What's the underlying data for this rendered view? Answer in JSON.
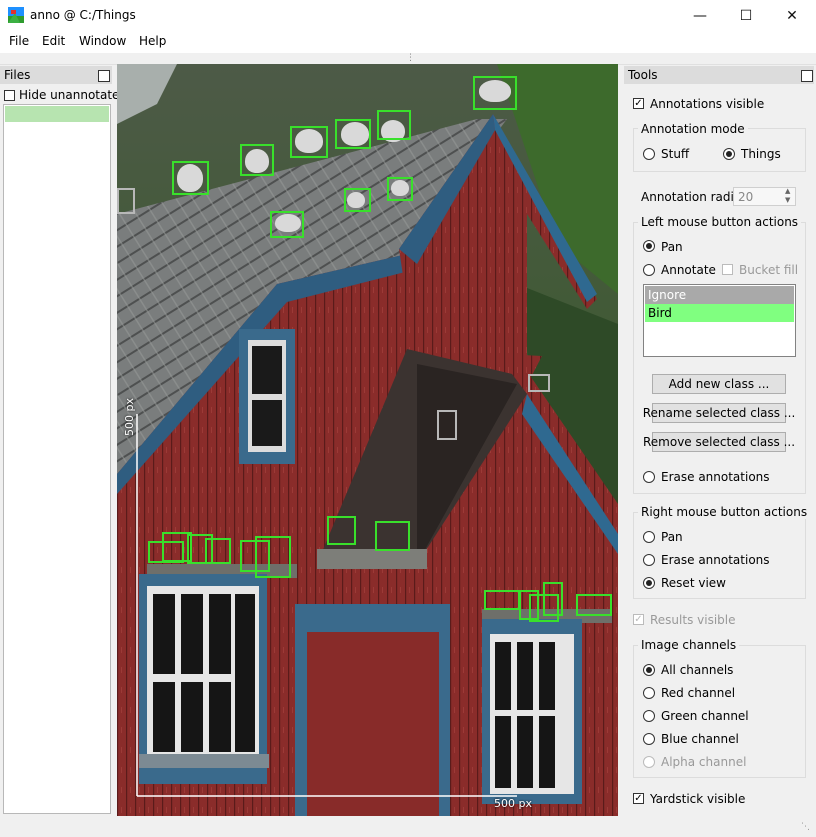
{
  "window": {
    "title": "anno @ C:/Things"
  },
  "menu": {
    "file": "File",
    "edit": "Edit",
    "window": "Window",
    "help": "Help"
  },
  "files_panel": {
    "title": "Files",
    "hide_unannotated": "Hide unannotated",
    "hide_unannotated_checked": false
  },
  "tools": {
    "title": "Tools",
    "annotations_visible": "Annotations visible",
    "annotations_visible_checked": true,
    "annotation_mode": {
      "title": "Annotation mode",
      "stuff": "Stuff",
      "things": "Things",
      "selected": "Things"
    },
    "annotation_radius": {
      "label": "Annotation radius",
      "value": "20"
    },
    "left_mouse": {
      "title": "Left mouse button actions",
      "pan": "Pan",
      "annotate": "Annotate",
      "bucket_fill": "Bucket fill",
      "selected": "Pan",
      "classes": [
        {
          "name": "Ignore",
          "color": "#a9a9a9"
        },
        {
          "name": "Bird",
          "color": "#80ff80"
        }
      ],
      "add_class": "Add new class ...",
      "rename_class": "Rename selected class ...",
      "remove_class": "Remove selected class ...",
      "erase": "Erase annotations"
    },
    "right_mouse": {
      "title": "Right mouse button actions",
      "pan": "Pan",
      "erase": "Erase annotations",
      "reset": "Reset view",
      "selected": "Reset view"
    },
    "results_visible": "Results visible",
    "image_channels": {
      "title": "Image channels",
      "all": "All channels",
      "red": "Red channel",
      "green": "Green channel",
      "blue": "Blue channel",
      "alpha": "Alpha channel",
      "selected": "All channels"
    },
    "yardstick_visible": "Yardstick visible",
    "yardstick_visible_checked": true
  },
  "viewport": {
    "yardstick_vertical": "500 px",
    "yardstick_horizontal": "500 px",
    "annotation_color": "#39e02b",
    "ignore_color": "#b8b8b8"
  }
}
